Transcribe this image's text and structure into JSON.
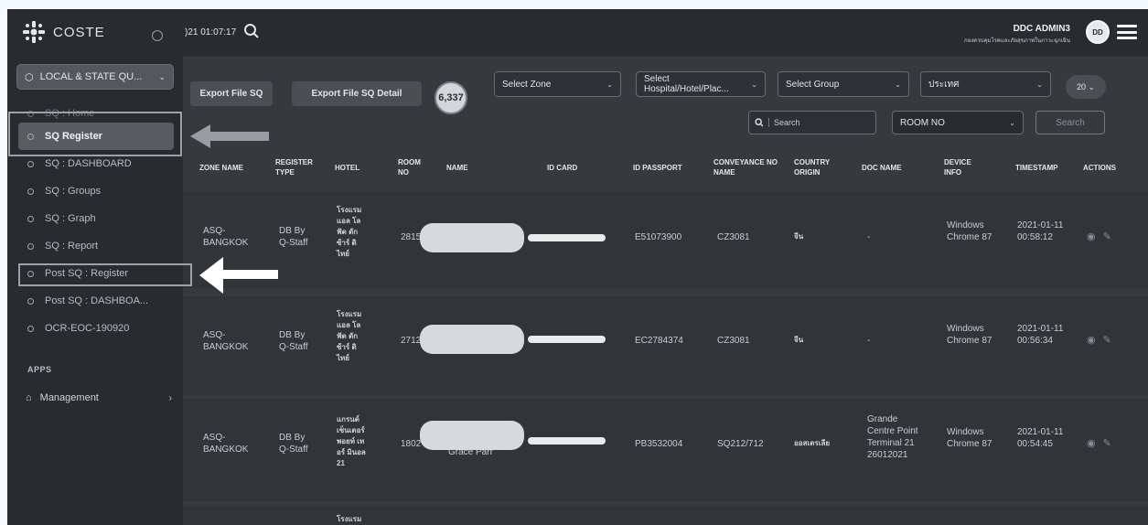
{
  "brand": {
    "name": "COSTE"
  },
  "sidebar": {
    "module": "LOCAL & STATE QU...",
    "items": [
      {
        "label": "SQ : Home"
      },
      {
        "label": "SQ Register",
        "active": true
      },
      {
        "label": "SQ : DASHBOARD"
      },
      {
        "label": "SQ : Groups"
      },
      {
        "label": "SQ : Graph"
      },
      {
        "label": "SQ : Report"
      },
      {
        "label": "Post SQ : Register"
      },
      {
        "label": "Post SQ : DASHBOA..."
      },
      {
        "label": "OCR-EOC-190920"
      }
    ],
    "apps_label": "APPS",
    "management_label": "Management"
  },
  "topbar": {
    "clock": ")21 01:07:17",
    "user_name": "DDC ADMIN3",
    "user_org": "กองควบคุมโรคและภัยสุขภาพในภาวะฉุกเฉิน",
    "avatar_text": "DD"
  },
  "toolbar": {
    "export_sq": "Export File SQ",
    "export_sq_detail": "Export File SQ Detail",
    "count": "6,337",
    "zone_select": "Select Zone",
    "hospital_select": "Select Hospital/Hotel/Plac...",
    "group_select": "Select Group",
    "country_select": "ประเทศ",
    "page_size": "20",
    "search_placeholder": "Search",
    "room_select": "ROOM NO",
    "search_button": "Search"
  },
  "table": {
    "headers": {
      "zone": "ZONE NAME",
      "register_type": "REGISTER TYPE",
      "hotel": "HOTEL",
      "room": "ROOM NO",
      "name": "NAME",
      "id_card": "ID CARD",
      "passport": "ID PASSPORT",
      "conveyance": "CONVEYANCE NO NAME",
      "country": "COUNTRY ORIGIN",
      "doc": "DOC NAME",
      "device": "DEVICE INFO",
      "timestamp": "TIMESTAMP",
      "actions": "ACTIONS"
    },
    "rows": [
      {
        "zone": "ASQ-BANGKOK",
        "register_type": "DB By Q-Staff",
        "hotel": "โรงแรม แอล โล ฟัด ดัก ซ้าร์ ดิ ไทย์",
        "room": "2815",
        "name": "",
        "passport": "E51073900",
        "conveyance": "CZ3081",
        "country": "จีน",
        "doc": "-",
        "device": "Windows Chrome 87",
        "timestamp": "2021-01-11 00:58:12"
      },
      {
        "zone": "ASQ-BANGKOK",
        "register_type": "DB By Q-Staff",
        "hotel": "โรงแรม แอล โล ฟัด ดัก ซ้าร์ ดิ ไทย์",
        "room": "2712",
        "name": "",
        "passport": "EC2784374",
        "conveyance": "CZ3081",
        "country": "จีน",
        "doc": "-",
        "device": "Windows Chrome 87",
        "timestamp": "2021-01-11 00:56:34"
      },
      {
        "zone": "ASQ-BANGKOK",
        "register_type": "DB By Q-Staff",
        "hotel": "แกรนด์ เซ็นเตอร์ พอยท์ เทอร์ มินอล 21",
        "room": "1802",
        "name": "Grace Parr",
        "passport": "PB3532004",
        "conveyance": "SQ212/712",
        "country": "ออสเตรเลีย",
        "doc": "Grande Centre Point Terminal 21 26012021",
        "device": "Windows Chrome 87",
        "timestamp": "2021-01-11 00:54:45"
      },
      {
        "hotel": "โรงแรม"
      }
    ]
  }
}
